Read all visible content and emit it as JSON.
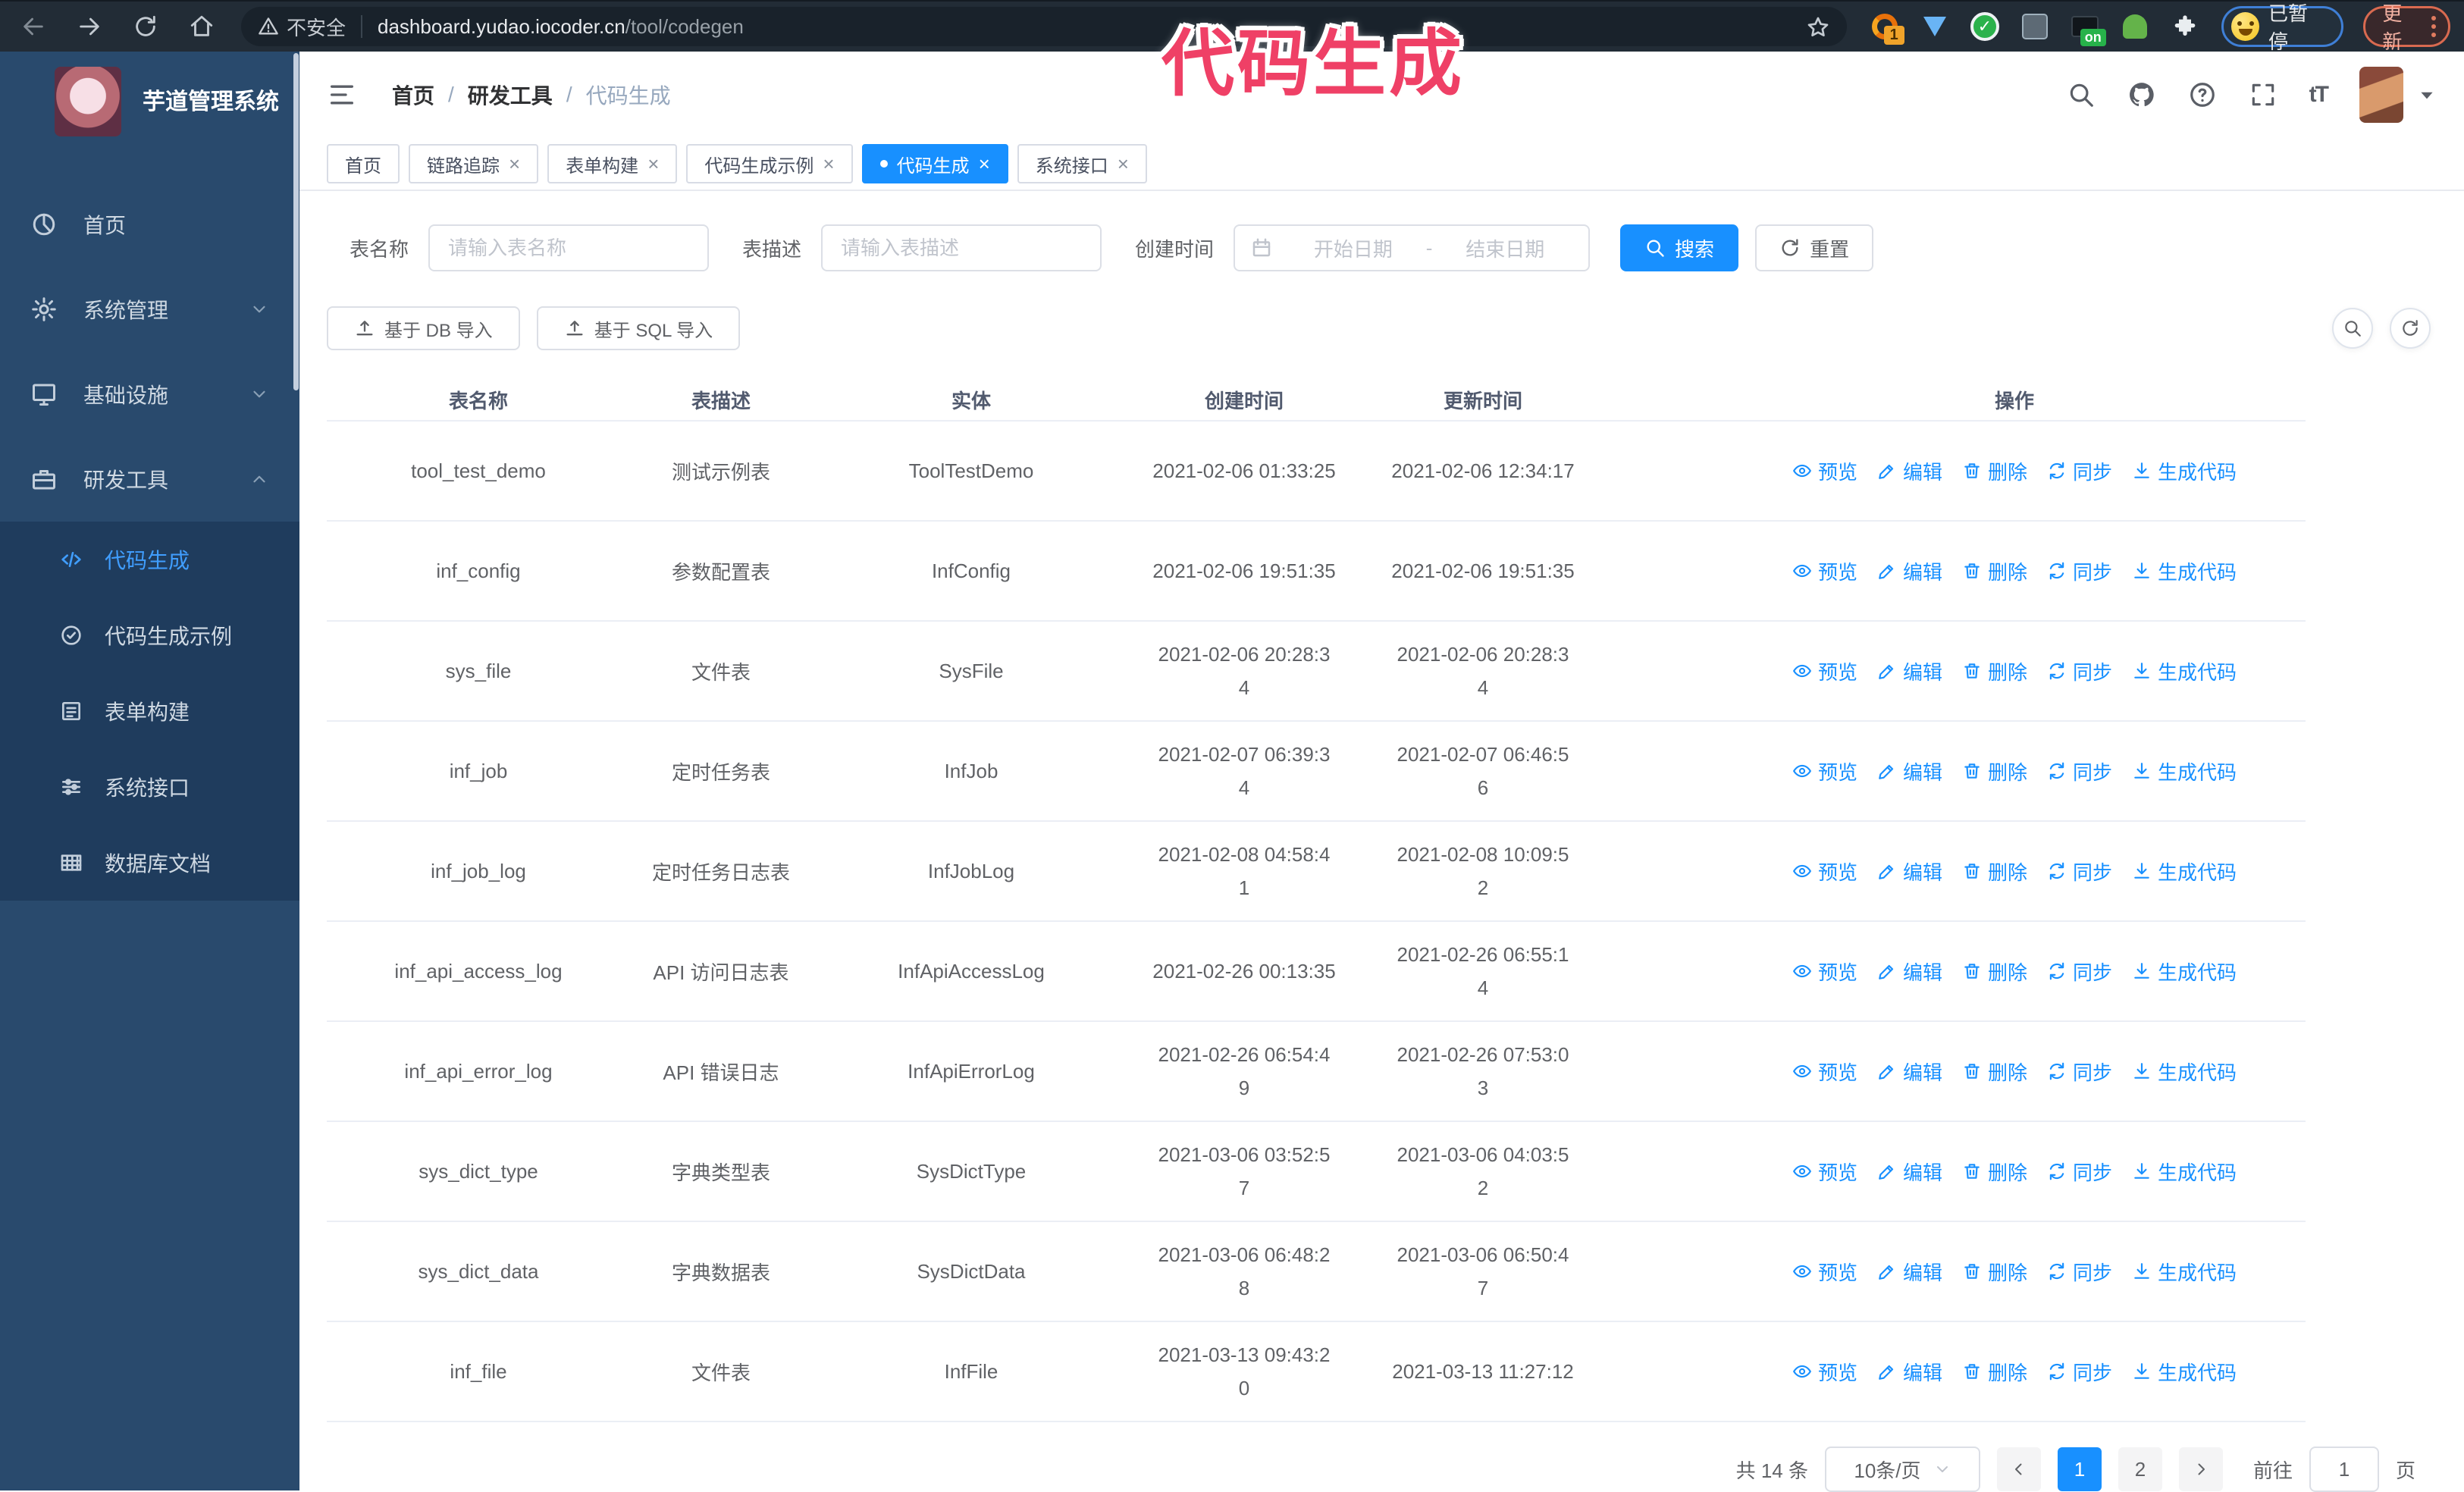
{
  "browser": {
    "security_label": "不安全",
    "url_domain": "dashboard.yudao.iocoder.cn",
    "url_path": "/tool/codegen",
    "extension_badge_count": "1",
    "extension_on_badge": "on",
    "paused_badge": "已暂停",
    "update_button": "更新"
  },
  "annotation": {
    "text": "代码生成",
    "color": "#ef4066"
  },
  "sidebar": {
    "logo_title": "芋道管理系统",
    "items": [
      {
        "label": "首页"
      },
      {
        "label": "系统管理"
      },
      {
        "label": "基础设施"
      },
      {
        "label": "研发工具"
      }
    ],
    "sub_items": [
      {
        "label": "代码生成",
        "active": true
      },
      {
        "label": "代码生成示例"
      },
      {
        "label": "表单构建"
      },
      {
        "label": "系统接口"
      },
      {
        "label": "数据库文档"
      }
    ]
  },
  "header": {
    "breadcrumb": [
      "首页",
      "研发工具",
      "代码生成"
    ],
    "separator": "/"
  },
  "icons": {
    "close": "×",
    "font_size": "tT"
  },
  "tabs": [
    {
      "label": "首页",
      "closable": false
    },
    {
      "label": "链路追踪",
      "closable": true
    },
    {
      "label": "表单构建",
      "closable": true
    },
    {
      "label": "代码生成示例",
      "closable": true
    },
    {
      "label": "代码生成",
      "closable": true,
      "active": true
    },
    {
      "label": "系统接口",
      "closable": true
    }
  ],
  "search_form": {
    "name_label": "表名称",
    "name_placeholder": "请输入表名称",
    "desc_label": "表描述",
    "desc_placeholder": "请输入表描述",
    "time_label": "创建时间",
    "start_placeholder": "开始日期",
    "range_separator": "-",
    "end_placeholder": "结束日期",
    "search_button": "搜索",
    "reset_button": "重置"
  },
  "toolbar": {
    "import_db_button": "基于 DB 导入",
    "import_sql_button": "基于 SQL 导入"
  },
  "table": {
    "columns": [
      "表名称",
      "表描述",
      "实体",
      "创建时间",
      "更新时间",
      "操作"
    ],
    "action_labels": {
      "preview": "预览",
      "edit": "编辑",
      "delete": "删除",
      "sync": "同步",
      "generate": "生成代码"
    },
    "rows": [
      {
        "name": "tool_test_demo",
        "desc": "测试示例表",
        "entity": "ToolTestDemo",
        "created": "2021-02-06 01:33:25",
        "updated": "2021-02-06 12:34:17"
      },
      {
        "name": "inf_config",
        "desc": "参数配置表",
        "entity": "InfConfig",
        "created": "2021-02-06 19:51:35",
        "updated": "2021-02-06 19:51:35"
      },
      {
        "name": "sys_file",
        "desc": "文件表",
        "entity": "SysFile",
        "created": "2021-02-06 20:28:3\n4",
        "updated": "2021-02-06 20:28:3\n4"
      },
      {
        "name": "inf_job",
        "desc": "定时任务表",
        "entity": "InfJob",
        "created": "2021-02-07 06:39:3\n4",
        "updated": "2021-02-07 06:46:5\n6"
      },
      {
        "name": "inf_job_log",
        "desc": "定时任务日志表",
        "entity": "InfJobLog",
        "created": "2021-02-08 04:58:4\n1",
        "updated": "2021-02-08 10:09:5\n2"
      },
      {
        "name": "inf_api_access_log",
        "desc": "API 访问日志表",
        "entity": "InfApiAccessLog",
        "created": "2021-02-26 00:13:35",
        "updated": "2021-02-26 06:55:1\n4"
      },
      {
        "name": "inf_api_error_log",
        "desc": "API 错误日志",
        "entity": "InfApiErrorLog",
        "created": "2021-02-26 06:54:4\n9",
        "updated": "2021-02-26 07:53:0\n3"
      },
      {
        "name": "sys_dict_type",
        "desc": "字典类型表",
        "entity": "SysDictType",
        "created": "2021-03-06 03:52:5\n7",
        "updated": "2021-03-06 04:03:5\n2"
      },
      {
        "name": "sys_dict_data",
        "desc": "字典数据表",
        "entity": "SysDictData",
        "created": "2021-03-06 06:48:2\n8",
        "updated": "2021-03-06 06:50:4\n7"
      },
      {
        "name": "inf_file",
        "desc": "文件表",
        "entity": "InfFile",
        "created": "2021-03-13 09:43:2\n0",
        "updated": "2021-03-13 11:27:12"
      }
    ]
  },
  "pagination": {
    "total": "共 14 条",
    "page_size": "10条/页",
    "page_1": "1",
    "page_2": "2",
    "goto_label": "前往",
    "goto_value": "1",
    "goto_unit": "页"
  },
  "colors": {
    "accent": "#1890ff",
    "sidebar_bg": "#294a6d",
    "submenu_bg": "#1f3c5d",
    "sidebar_active": "#409eff",
    "annotation_pink": "#ef4066",
    "browser_bar_bg": "#222c36"
  }
}
